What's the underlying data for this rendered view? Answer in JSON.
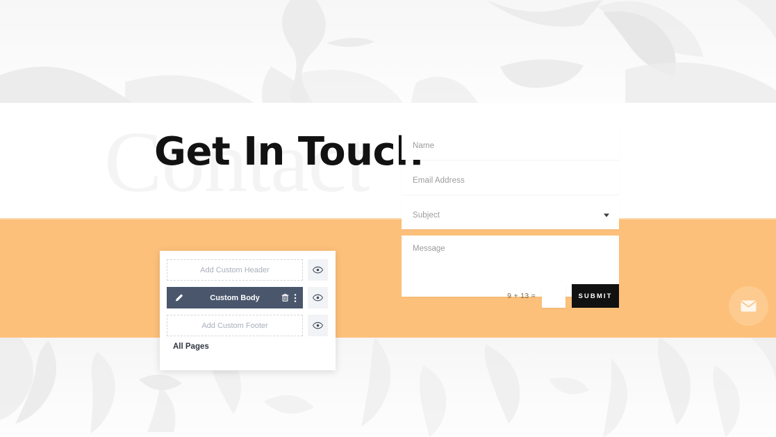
{
  "hero": {
    "watermark_text": "Contact",
    "title": "Get In Touch"
  },
  "colors": {
    "band_orange": "#fdc07a",
    "panel_active": "#49566c",
    "submit_bg": "#111111",
    "placeholder_text": "#9b9b9b"
  },
  "form": {
    "fields": [
      {
        "name": "Name",
        "placeholder": "Name",
        "type": "text"
      },
      {
        "name": "Email Address",
        "placeholder": "Email Address",
        "type": "email"
      },
      {
        "name": "Subject",
        "placeholder": "Subject",
        "type": "select"
      }
    ],
    "message": {
      "placeholder": "Message",
      "value": ""
    },
    "captcha": {
      "question": "9 + 13 =",
      "value": ""
    },
    "submit_label": "SUBMIT"
  },
  "fab": {
    "icon": "envelope-icon",
    "label": "Email"
  },
  "builder_panel": {
    "rows": [
      {
        "label": "Add Custom Header",
        "state": "placeholder",
        "visibility_icon": "eye-icon"
      },
      {
        "label": "Custom Body",
        "state": "active",
        "visibility_icon": "eye-icon",
        "actions": [
          "pencil-icon",
          "trash-icon",
          "more-vertical-icon"
        ]
      },
      {
        "label": "Add Custom Footer",
        "state": "placeholder",
        "visibility_icon": "eye-icon"
      }
    ],
    "scope_label": "All Pages"
  }
}
